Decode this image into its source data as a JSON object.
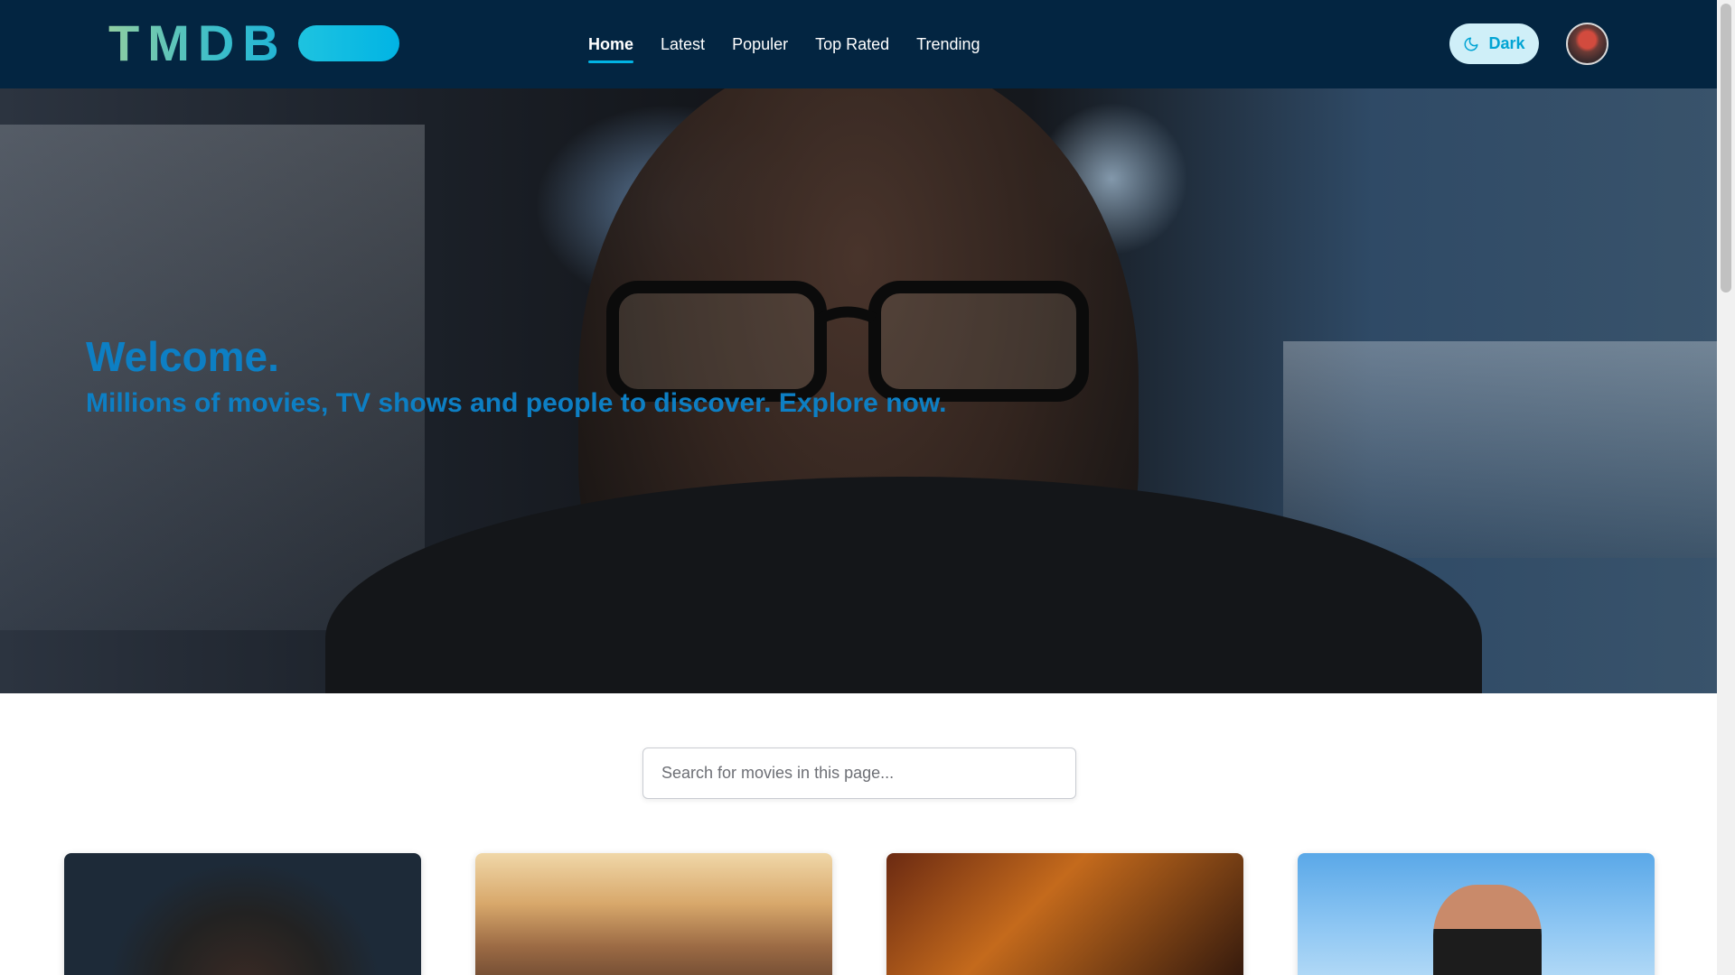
{
  "navbar": {
    "logo_text": "TMDB",
    "links": [
      {
        "label": "Home",
        "active": true
      },
      {
        "label": "Latest",
        "active": false
      },
      {
        "label": "Populer",
        "active": false
      },
      {
        "label": "Top Rated",
        "active": false
      },
      {
        "label": "Trending",
        "active": false
      }
    ],
    "theme_toggle": {
      "label": "Dark",
      "icon": "moon-icon"
    },
    "avatar": {
      "icon": "user-avatar"
    }
  },
  "hero": {
    "title": "Welcome.",
    "subtitle": "Millions of movies, TV shows and people to discover. Explore now."
  },
  "search": {
    "placeholder": "Search for movies in this page...",
    "value": ""
  },
  "movies": [
    {
      "poster": "movie-poster-1"
    },
    {
      "poster": "movie-poster-2"
    },
    {
      "poster": "movie-poster-3"
    },
    {
      "poster": "movie-poster-4"
    }
  ],
  "colors": {
    "navbar_bg": "#032541",
    "accent": "#01b4e4",
    "hero_text": "#0d7fc4",
    "theme_button_bg": "#cfeff8"
  }
}
